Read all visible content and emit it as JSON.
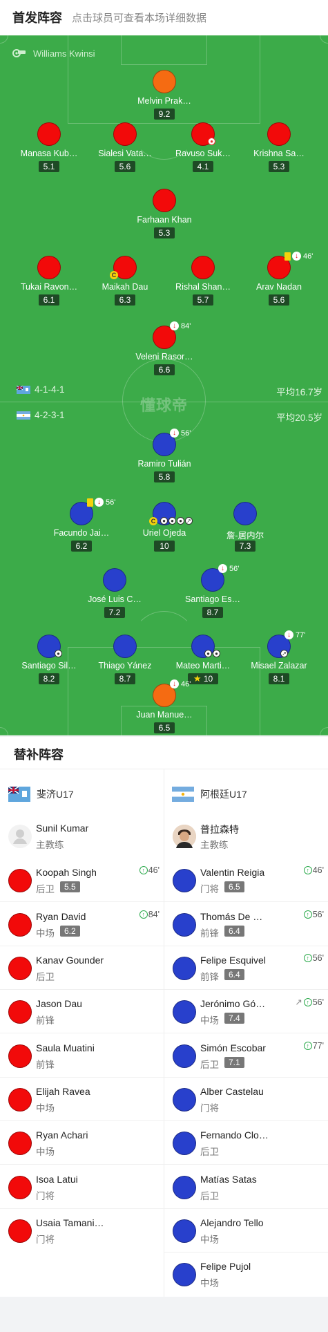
{
  "header": {
    "title": "首发阵容",
    "subtitle": "点击球员可查看本场详细数据"
  },
  "referee": {
    "icon": "whistle-icon",
    "name": "Williams Kwinsi"
  },
  "watermark": "懂球帝",
  "colors": {
    "pitch": "#3cab49",
    "home": "#f20a0a",
    "away": "#2840cc",
    "keeper": "#f56b12"
  },
  "home": {
    "formation": "4-1-4-1",
    "avg_age": "平均16.7岁",
    "players": [
      {
        "name": "Melvin Prak…",
        "rating": "9.2",
        "kit": "orange"
      },
      {
        "name": "Manasa Kub…",
        "rating": "5.1",
        "kit": "red"
      },
      {
        "name": "Sialesi Vata…",
        "rating": "5.6",
        "kit": "red"
      },
      {
        "name": "Ravuso Suk…",
        "rating": "4.1",
        "kit": "red"
      },
      {
        "name": "Krishna Sa…",
        "rating": "5.3",
        "kit": "red"
      },
      {
        "name": "Farhaan Khan",
        "rating": "5.3",
        "kit": "red"
      },
      {
        "name": "Tukai Ravon…",
        "rating": "6.1",
        "kit": "red"
      },
      {
        "name": "Maikah Dau",
        "rating": "6.3",
        "kit": "red"
      },
      {
        "name": "Rishal Shan…",
        "rating": "5.7",
        "kit": "red"
      },
      {
        "name": "Arav Nadan",
        "rating": "5.6",
        "kit": "red",
        "event": "46'"
      },
      {
        "name": "Veleni Rasor…",
        "rating": "6.6",
        "kit": "red",
        "event": "84'"
      }
    ]
  },
  "away": {
    "formation": "4-2-3-1",
    "avg_age": "平均20.5岁",
    "players": [
      {
        "name": "Ramiro Tulián",
        "rating": "5.8",
        "kit": "blue",
        "event": "56'"
      },
      {
        "name": "Facundo Jai…",
        "rating": "6.2",
        "kit": "blue",
        "event": "56'"
      },
      {
        "name": "Uriel Ojeda",
        "rating": "10",
        "kit": "blue"
      },
      {
        "name": "詹-居内尔",
        "rating": "7.3",
        "kit": "blue"
      },
      {
        "name": "José Luis C…",
        "rating": "7.2",
        "kit": "blue"
      },
      {
        "name": "Santiago Es…",
        "rating": "8.7",
        "kit": "blue",
        "event": "56'"
      },
      {
        "name": "Santiago Sil…",
        "rating": "8.2",
        "kit": "blue"
      },
      {
        "name": "Thiago Yánez",
        "rating": "8.7",
        "kit": "blue"
      },
      {
        "name": "Mateo Marti…",
        "rating": "10",
        "kit": "blue"
      },
      {
        "name": "Misael Zalazar",
        "rating": "8.1",
        "kit": "blue",
        "event": "77'"
      },
      {
        "name": "Juan Manue…",
        "rating": "6.5",
        "kit": "orange",
        "event": "46'"
      }
    ]
  },
  "subs": {
    "title": "替补阵容",
    "home_team": "斐济U17",
    "away_team": "阿根廷U17",
    "home_coach": {
      "name": "Sunil Kumar",
      "role": "主教练"
    },
    "away_coach": {
      "name": "普拉森特",
      "role": "主教练"
    },
    "home_list": [
      {
        "name": "Koopah Singh",
        "pos": "后卫",
        "score": "5.5",
        "time": "46'"
      },
      {
        "name": "Ryan David",
        "pos": "中场",
        "score": "6.2",
        "time": "84'"
      },
      {
        "name": "Kanav Gounder",
        "pos": "后卫"
      },
      {
        "name": "Jason Dau",
        "pos": "前锋"
      },
      {
        "name": "Saula Muatini",
        "pos": "前锋"
      },
      {
        "name": "Elijah Ravea",
        "pos": "中场"
      },
      {
        "name": "Ryan Achari",
        "pos": "中场"
      },
      {
        "name": "Isoa Latui",
        "pos": "门将"
      },
      {
        "name": "Usaia Tamani…",
        "pos": "门将"
      }
    ],
    "away_list": [
      {
        "name": "Valentin Reigia",
        "pos": "门将",
        "score": "6.5",
        "time": "46'"
      },
      {
        "name": "Thomás De …",
        "pos": "前锋",
        "score": "6.4",
        "time": "56'"
      },
      {
        "name": "Felipe Esquivel",
        "pos": "前锋",
        "score": "6.4",
        "time": "56'"
      },
      {
        "name": "Jerónimo Gó…",
        "pos": "中场",
        "score": "7.4",
        "time": "56'"
      },
      {
        "name": "Simón Escobar",
        "pos": "后卫",
        "score": "7.1",
        "time": "77'"
      },
      {
        "name": "Alber Castelau",
        "pos": "门将"
      },
      {
        "name": "Fernando Clo…",
        "pos": "后卫"
      },
      {
        "name": "Matías Satas",
        "pos": "后卫"
      },
      {
        "name": "Alejandro Tello",
        "pos": "中场"
      },
      {
        "name": "Felipe Pujol",
        "pos": "中场"
      }
    ]
  }
}
